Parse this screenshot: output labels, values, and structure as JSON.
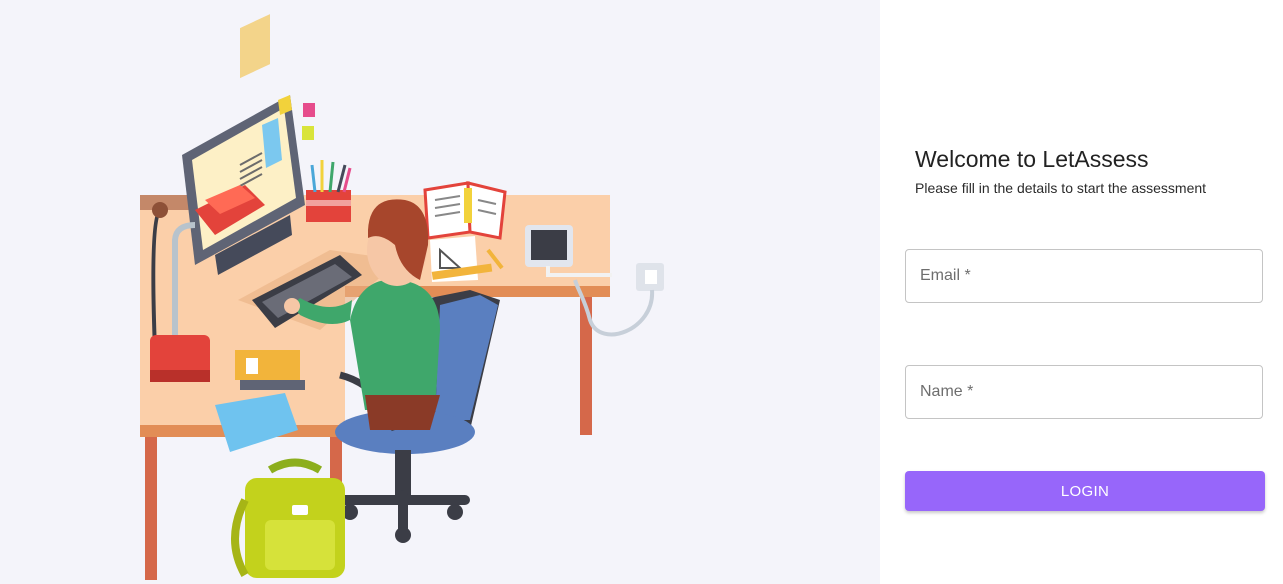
{
  "illustration": {
    "icon": "student-at-desk-illustration",
    "colors": {
      "background": "#f4f4fa",
      "desk": "#fbcfa9",
      "shirt": "#3fa76b",
      "hair": "#a7462c",
      "chair": "#5a7fc0",
      "backpack": "#c3d21c",
      "lamp": "#e3433b"
    }
  },
  "welcome": {
    "title": "Welcome to LetAssess",
    "subtitle": "Please fill in the details to start the assessment"
  },
  "form": {
    "email_label": "Email *",
    "name_label": "Name *",
    "login_label": "LOGIN"
  },
  "colors": {
    "accent": "#9766fa",
    "field_border": "#c4c4c4"
  }
}
